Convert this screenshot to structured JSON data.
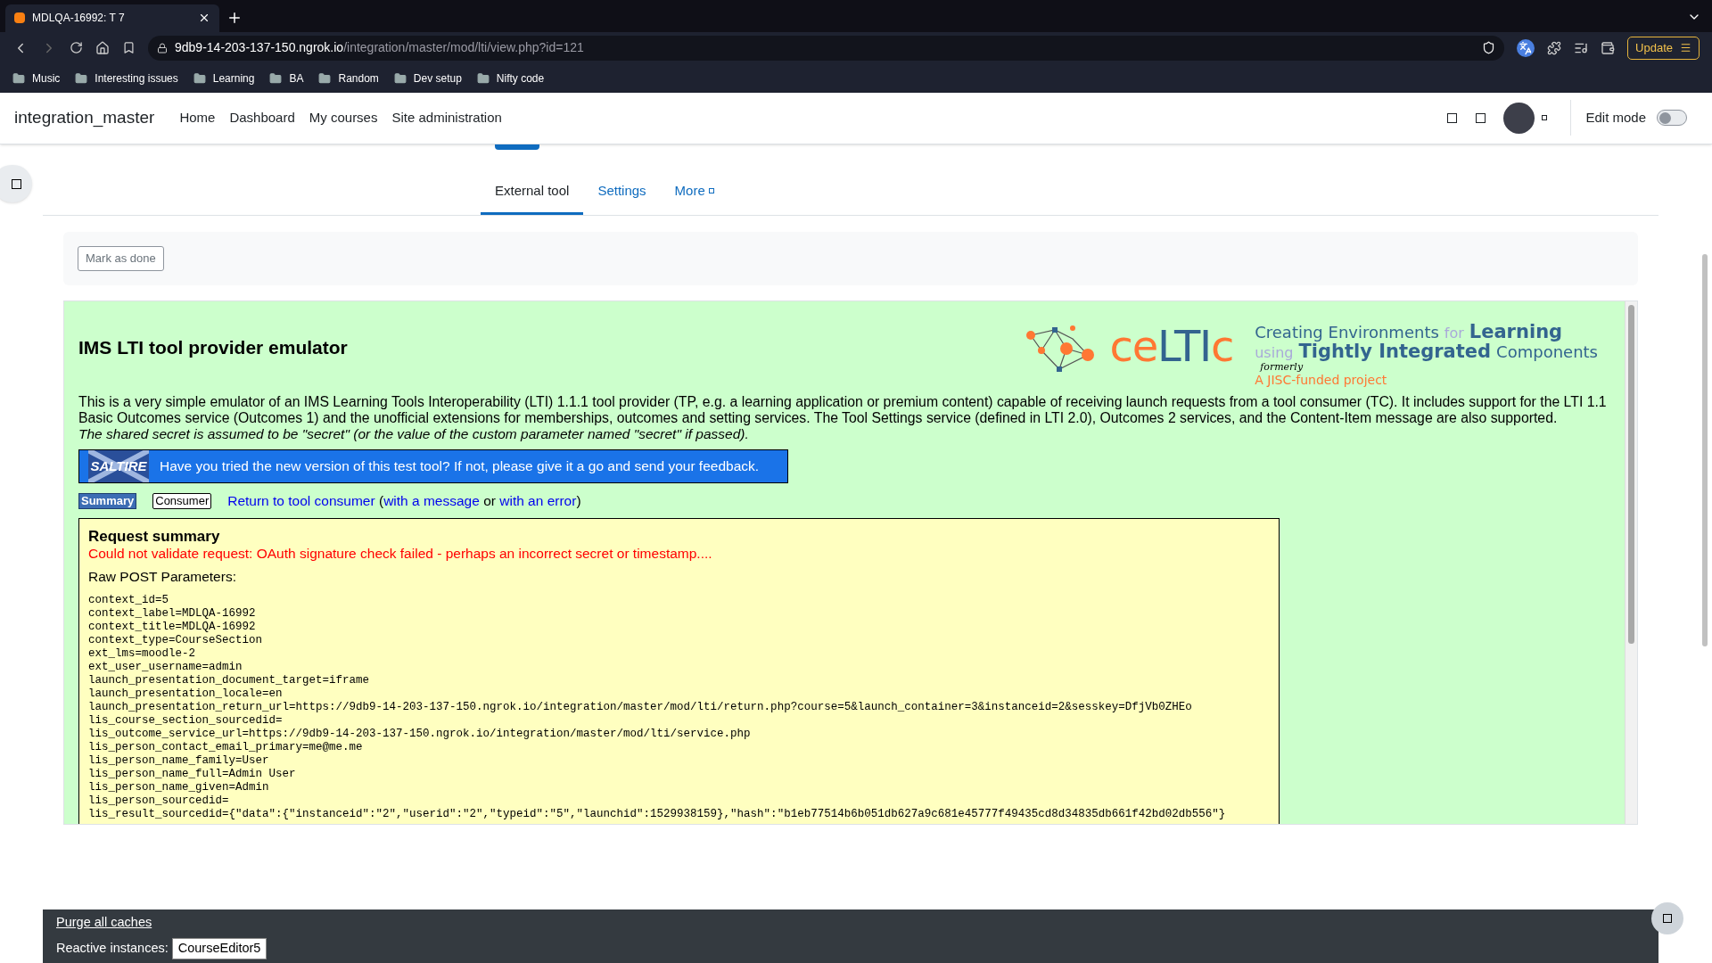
{
  "browser": {
    "tab_title": "MDLQA-16992: T 7",
    "url_host": "9db9-14-203-137-150.ngrok.io",
    "url_path": "/integration/master/mod/lti/view.php?id=121",
    "update_label": "Update",
    "bookmarks": [
      "Music",
      "Interesting issues",
      "Learning",
      "BA",
      "Random",
      "Dev setup",
      "Nifty code"
    ]
  },
  "navbar": {
    "site_name": "integration_master",
    "items": [
      "Home",
      "Dashboard",
      "My courses",
      "Site administration"
    ],
    "edit_mode": {
      "label": "Edit mode",
      "on": false
    }
  },
  "secondary_tabs": [
    {
      "label": "External tool",
      "selected": true
    },
    {
      "label": "Settings",
      "selected": false
    },
    {
      "label": "More",
      "selected": false
    }
  ],
  "mark_done": "Mark as done",
  "emulator": {
    "title": "IMS LTI tool provider emulator",
    "logo_parts": [
      {
        "text": "ce",
        "color": "#ff7733"
      },
      {
        "text": "LTI",
        "color": "#33648f"
      },
      {
        "text": "c",
        "color": "#ff7733"
      }
    ],
    "tagline": [
      [
        {
          "text": "Creating Environments",
          "kind": "normal"
        },
        {
          "text": "for",
          "kind": "faint"
        },
        {
          "text": "Learning",
          "kind": "bold"
        }
      ],
      [
        {
          "text": "using",
          "kind": "faint"
        },
        {
          "text": "Tightly Integrated",
          "kind": "bold"
        },
        {
          "text": "Components",
          "kind": "normal"
        }
      ]
    ],
    "formerly": "formerly",
    "funded": "A JISC-funded project",
    "intro": "This is a very simple emulator of an IMS Learning Tools Interoperability (LTI) 1.1.1 tool provider (TP, e.g. a learning application or premium content) capable of receiving launch requests from a tool consumer (TC). It includes support for the LTI 1.1 Basic Outcomes service (Outcomes 1) and the unofficial extensions for memberships, outcomes and setting services. The Tool Settings service (defined in LTI 2.0), Outcomes 2 services, and the Content-Item message are also supported.",
    "secret_note": "The shared secret is assumed to be \"secret\" (or the value of the custom parameter named \"secret\" if passed).",
    "banner_logo": "SALTIRE",
    "banner_text": "Have you tried the new version of this test tool? If not, please give it a go and send your feedback.",
    "view_buttons": [
      {
        "label": "Summary",
        "selected": true
      },
      {
        "label": "Consumer",
        "selected": false
      }
    ],
    "return_link": "Return to tool consumer",
    "open_paren": "(",
    "message_link": "with a message",
    "or": "or",
    "error_link": "with an error",
    "close_paren": ")",
    "summary_title": "Request summary",
    "error": "Could not validate request: OAuth signature check failed - perhaps an incorrect secret or timestamp....",
    "raw_heading": "Raw POST Parameters:",
    "params": [
      "context_id=5",
      "context_label=MDLQA-16992",
      "context_title=MDLQA-16992",
      "context_type=CourseSection",
      "ext_lms=moodle-2",
      "ext_user_username=admin",
      "launch_presentation_document_target=iframe",
      "launch_presentation_locale=en",
      "launch_presentation_return_url=https://9db9-14-203-137-150.ngrok.io/integration/master/mod/lti/return.php?course=5&launch_container=3&instanceid=2&sesskey=DfjVb0ZHEo",
      "lis_course_section_sourcedid=",
      "lis_outcome_service_url=https://9db9-14-203-137-150.ngrok.io/integration/master/mod/lti/service.php",
      "lis_person_contact_email_primary=me@me.me",
      "lis_person_name_family=User",
      "lis_person_name_full=Admin User",
      "lis_person_name_given=Admin",
      "lis_person_sourcedid=",
      "lis_result_sourcedid={\"data\":{\"instanceid\":\"2\",\"userid\":\"2\",\"typeid\":\"5\",\"launchid\":1529938159},\"hash\":\"b1eb77514b6b051db627a9c681e45777f49435cd8d34835db661f42bd02db556\"}"
    ]
  },
  "footer": {
    "purge": "Purge all caches",
    "reactive_label": "Reactive instances:",
    "reactive_button": "CourseEditor5"
  }
}
